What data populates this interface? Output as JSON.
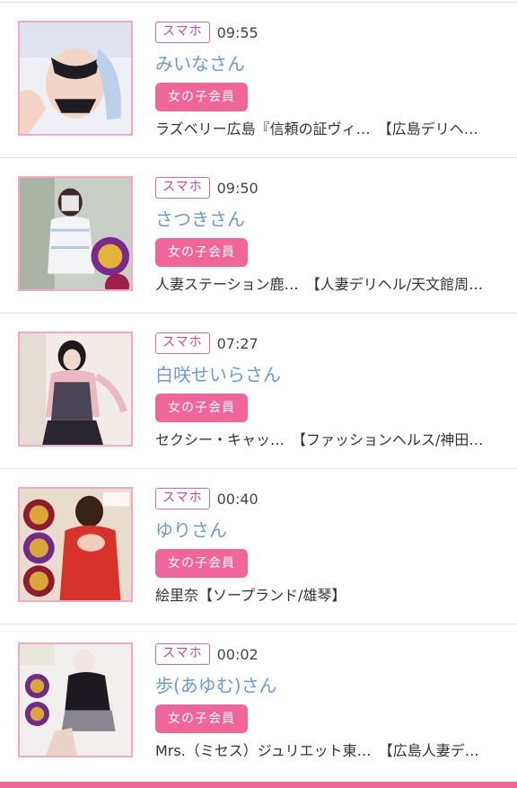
{
  "colors": {
    "accent": "#f06698",
    "name_link": "#6b9bd4",
    "badge_border": "#e06a9e"
  },
  "posts": [
    {
      "device": "スマホ",
      "time": "09:55",
      "name": "みいなさん",
      "member": "女の子会員",
      "shop": "ラズベリー広島『信頼の証ヴィ…",
      "category": "【広島デリヘ…",
      "thumb_icon": "profile-photo"
    },
    {
      "device": "スマホ",
      "time": "09:50",
      "name": "さつきさん",
      "member": "女の子会員",
      "shop": "人妻ステーション鹿…",
      "category": "【人妻デリヘル/天文館周…",
      "thumb_icon": "profile-photo"
    },
    {
      "device": "スマホ",
      "time": "07:27",
      "name": "白咲せいらさん",
      "member": "女の子会員",
      "shop": "セクシー・キャッ…",
      "category": "【ファッションヘルス/神田…",
      "thumb_icon": "profile-photo"
    },
    {
      "device": "スマホ",
      "time": "00:40",
      "name": "ゆりさん",
      "member": "女の子会員",
      "shop": "絵里奈",
      "category": "【ソープランド/雄琴】",
      "thumb_icon": "profile-photo"
    },
    {
      "device": "スマホ",
      "time": "00:02",
      "name": "歩(あゆむ)さん",
      "member": "女の子会員",
      "shop": "Mrs.（ミセス）ジュリエット東…",
      "category": "【広島人妻デ…",
      "thumb_icon": "profile-photo"
    }
  ]
}
